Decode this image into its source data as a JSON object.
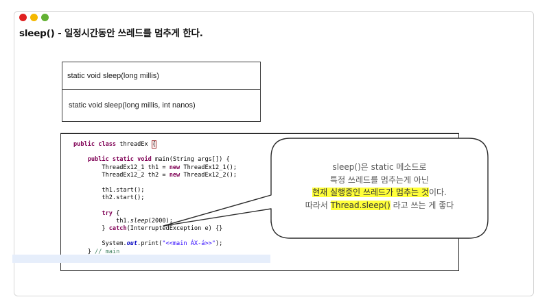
{
  "window": {
    "dot_colors": [
      "#e02020",
      "#f5b800",
      "#62b133"
    ]
  },
  "title": "sleep() - 일정시간동안 쓰레드를 멈추게 한다.",
  "signatures": [
    "static void sleep(long millis)",
    "static void sleep(long millis, int nanos)"
  ],
  "code_lines": [
    {
      "segments": [
        {
          "t": "public class",
          "c": "kw"
        },
        {
          "t": " threadEx "
        },
        {
          "t": "{",
          "c": "brace-mark"
        }
      ]
    },
    {
      "segments": []
    },
    {
      "segments": [
        {
          "t": "    "
        },
        {
          "t": "public static void",
          "c": "kw"
        },
        {
          "t": " main(String args[]) {"
        }
      ]
    },
    {
      "segments": [
        {
          "t": "        ThreadEx12_1 th1 = "
        },
        {
          "t": "new",
          "c": "kw"
        },
        {
          "t": " ThreadEx12_1();"
        }
      ]
    },
    {
      "segments": [
        {
          "t": "        ThreadEx12_2 th2 = "
        },
        {
          "t": "new",
          "c": "kw"
        },
        {
          "t": " ThreadEx12_2();"
        }
      ]
    },
    {
      "segments": []
    },
    {
      "segments": [
        {
          "t": "        th1.start();"
        }
      ]
    },
    {
      "segments": [
        {
          "t": "        th2.start();"
        }
      ]
    },
    {
      "segments": []
    },
    {
      "segments": [
        {
          "t": "        "
        },
        {
          "t": "try",
          "c": "kw"
        },
        {
          "t": " {"
        }
      ]
    },
    {
      "segments": [
        {
          "t": "            th1."
        },
        {
          "t": "sleep",
          "c": "ital"
        },
        {
          "t": "(2000);"
        }
      ]
    },
    {
      "segments": [
        {
          "t": "        } "
        },
        {
          "t": "catch",
          "c": "kw"
        },
        {
          "t": "(InterruptedException e) {}"
        }
      ]
    },
    {
      "segments": []
    },
    {
      "segments": [
        {
          "t": "        System."
        },
        {
          "t": "out",
          "c": "fld"
        },
        {
          "t": ".print("
        },
        {
          "t": "\"<<main ÁX-á>>\"",
          "c": "str"
        },
        {
          "t": ");"
        }
      ]
    },
    {
      "segments": [
        {
          "t": "    } "
        },
        {
          "t": "// main",
          "c": "cmt"
        }
      ]
    },
    {
      "segments": [
        {
          "t": "}"
        }
      ]
    }
  ],
  "callout": {
    "lines": [
      [
        {
          "t": "sleep()은 static 메소드로"
        }
      ],
      [
        {
          "t": "특정 쓰레드를 멈추는게 아닌"
        }
      ],
      [
        {
          "t": "현재 실행중인 쓰레드가 멈추는 것",
          "hl": true
        },
        {
          "t": "이다."
        }
      ],
      [
        {
          "t": "따라서 "
        },
        {
          "t": "Thread.sleep()",
          "hl": true
        },
        {
          "t": " 라고 쓰는 게 좋다"
        }
      ]
    ],
    "highlight_color": "#ffff3a"
  }
}
